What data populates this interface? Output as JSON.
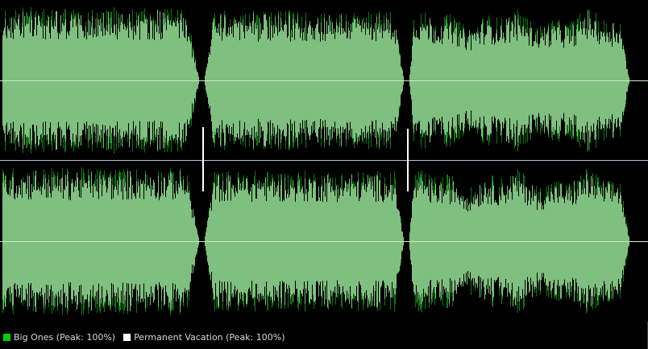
{
  "waveform_view": {
    "channels": 2,
    "tracks": [
      {
        "name": "Big Ones",
        "peak_percent": 100
      },
      {
        "name": "Permanent Vacation",
        "peak_percent": 100
      }
    ],
    "colors": {
      "background": "#000000",
      "waveform_dark": "#0a7a10",
      "waveform_light": "#7fbf7f",
      "centerline": "#c9efc9",
      "divider": "#b7c2d8",
      "marker": "#ffffff"
    }
  },
  "legend": {
    "items": [
      {
        "label": "Big Ones (Peak: 100%)",
        "color": "#00d000"
      },
      {
        "label": "Permanent Vacation (Peak: 100%)",
        "color": "#ffffff"
      }
    ]
  }
}
